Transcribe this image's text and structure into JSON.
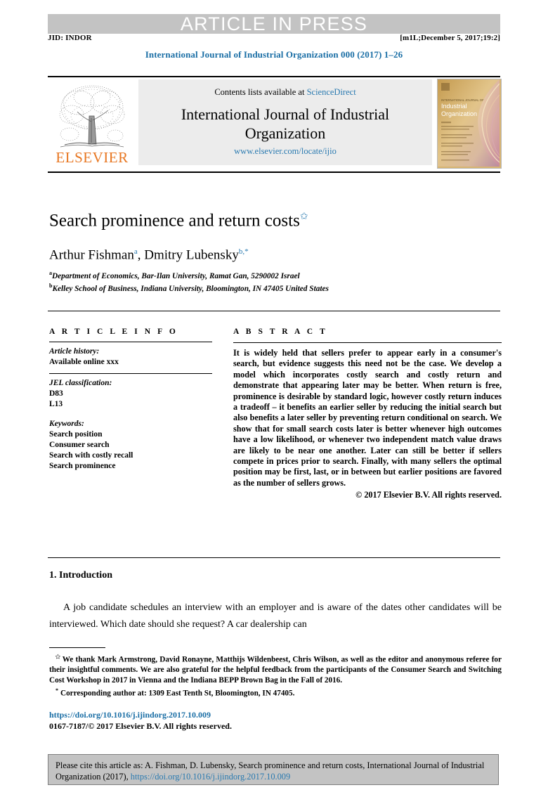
{
  "banner": {
    "press_text": "ARTICLE IN PRESS",
    "jid": "JID: INDOR",
    "stamp": "[m1L;December 5, 2017;19:2]",
    "journal_line": "International Journal of Industrial Organization 000 (2017) 1–26"
  },
  "masthead": {
    "contents_prefix": "Contents lists available at ",
    "sciencedirect": "ScienceDirect",
    "journal_title": "International Journal of Industrial Organization",
    "journal_url": "www.elsevier.com/locate/ijio",
    "publisher": "ELSEVIER",
    "cover_line1": "INTERNATIONAL JOURNAL OF",
    "cover_line2": "Industrial",
    "cover_line3": "Organization"
  },
  "article": {
    "title": "Search prominence and return costs",
    "title_mark": "✩",
    "authors_1": "Arthur Fishman",
    "authors_1_sup": "a",
    "authors_sep": ", ",
    "authors_2": "Dmitry Lubensky",
    "authors_2_sup": "b,",
    "authors_2_sup2": "*",
    "affiliation_a_mark": "a",
    "affiliation_a": "Department of Economics, Bar-Ilan University, Ramat Gan, 5290002 Israel",
    "affiliation_b_mark": "b",
    "affiliation_b": "Kelley School of Business, Indiana University, Bloomington, IN 47405 United States"
  },
  "info": {
    "heading": "A R T I C L E   I N F O",
    "history_label": "Article history:",
    "history_value": "Available online xxx",
    "jel_label": "JEL classification:",
    "jel_codes": [
      "D83",
      "L13"
    ],
    "keywords_label": "Keywords:",
    "keywords": [
      "Search position",
      "Consumer search",
      "Search with costly recall",
      "Search prominence"
    ]
  },
  "abstract": {
    "heading": "A B S T R A C T",
    "body": "It is widely held that sellers prefer to appear early in a consumer's search, but evidence suggests this need not be the case. We develop a model which incorporates costly search and costly return and demonstrate that appearing later may be better. When return is free, prominence is desirable by standard logic, however costly return induces a tradeoff – it benefits an earlier seller by reducing the initial search but also benefits a later seller by preventing return conditional on search. We show that for small search costs later is better whenever high outcomes have a low likelihood, or whenever two independent match value draws are likely to be near one another. Later can still be better if sellers compete in prices prior to search. Finally, with many sellers the optimal position may be first, last, or in between but earlier positions are favored as the number of sellers grows.",
    "copyright": "© 2017 Elsevier B.V. All rights reserved."
  },
  "introduction": {
    "heading": "1. Introduction",
    "paragraph": "A job candidate schedules an interview with an employer and is aware of the dates other candidates will be interviewed. Which date should she request? A car dealership can"
  },
  "footnotes": {
    "star_mark": "✩",
    "star_text": "We thank Mark Armstrong, David Ronayne, Matthijs Wildenbeest, Chris Wilson, as well as the editor and anonymous referee for their insightful comments. We are also grateful for the helpful feedback from the participants of the Consumer Search and Switching Cost Workshop in 2017 in Vienna and the Indiana BEPP Brown Bag in the Fall of 2016.",
    "corr_mark": "*",
    "corr_text": "Corresponding author at: 1309 East Tenth St, Bloomington, IN 47405."
  },
  "bottom": {
    "doi": "https://doi.org/10.1016/j.ijindorg.2017.10.009",
    "copyright": "0167-7187/© 2017 Elsevier B.V. All rights reserved."
  },
  "cite": {
    "prefix": "Please cite this article as: A. Fishman, D. Lubensky, Search prominence and return costs, International Journal of Industrial Organization (2017), ",
    "link": "https://doi.org/10.1016/j.ijindorg.2017.10.009"
  },
  "colors": {
    "link_blue": "#2a7ab0",
    "heading_blue": "#1a6ea5",
    "elsevier_orange": "#e87722",
    "band_gray": "#c3c3c3",
    "box_gray": "#ececec"
  }
}
